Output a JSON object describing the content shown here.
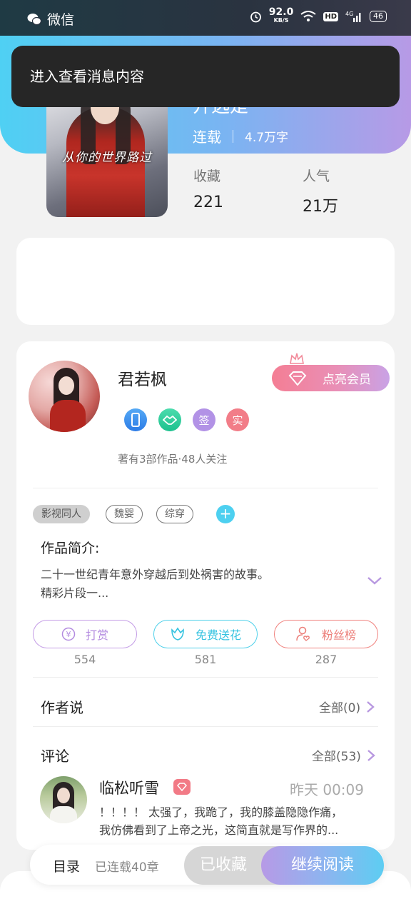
{
  "status_bar": {
    "app": "微信",
    "speed": "92.0",
    "speed_unit": "KB/S",
    "hd": "HD",
    "network": "4G",
    "battery": "46"
  },
  "toast": {
    "text": "进入查看消息内容"
  },
  "book": {
    "title_partial": "开选是",
    "cover_title": "从你的世界路过",
    "status": "连载",
    "words": "4.7万字",
    "stats": [
      {
        "label": "收藏",
        "value": "221"
      },
      {
        "label": "人气",
        "value": "21万"
      }
    ]
  },
  "author": {
    "name": "君若枫",
    "vip_label": "点亮会员",
    "badges": [
      "签",
      "实"
    ],
    "meta": "著有3部作品·48人关注"
  },
  "tags": [
    "影视同人",
    "魏婴",
    "综穿"
  ],
  "intro": {
    "title": "作品简介:",
    "line1": "二十一世纪青年意外穿越后到处祸害的故事。",
    "line2": "精彩片段一..."
  },
  "actions": [
    {
      "label": "打赏",
      "count": "554"
    },
    {
      "label": "免费送花",
      "count": "581"
    },
    {
      "label": "粉丝榜",
      "count": "287"
    }
  ],
  "author_says": {
    "title": "作者说",
    "link": "全部(0)"
  },
  "comments": {
    "title": "评论",
    "link": "全部(53)",
    "item": {
      "name": "临松听雪",
      "time": "昨天 00:09",
      "line1": "！！！！ 太强了，我跪了，我的膝盖隐隐作痛，",
      "line2": "我仿佛看到了上帝之光，这简直就是写作界的..."
    }
  },
  "bottom": {
    "toc": "目录",
    "chapters": "已连载40章",
    "collected": "已收藏",
    "read": "继续阅读"
  },
  "colors": {
    "accent_cyan": "#4fd0f3",
    "accent_purple": "#b79ae6",
    "accent_pink": "#f47e94"
  }
}
